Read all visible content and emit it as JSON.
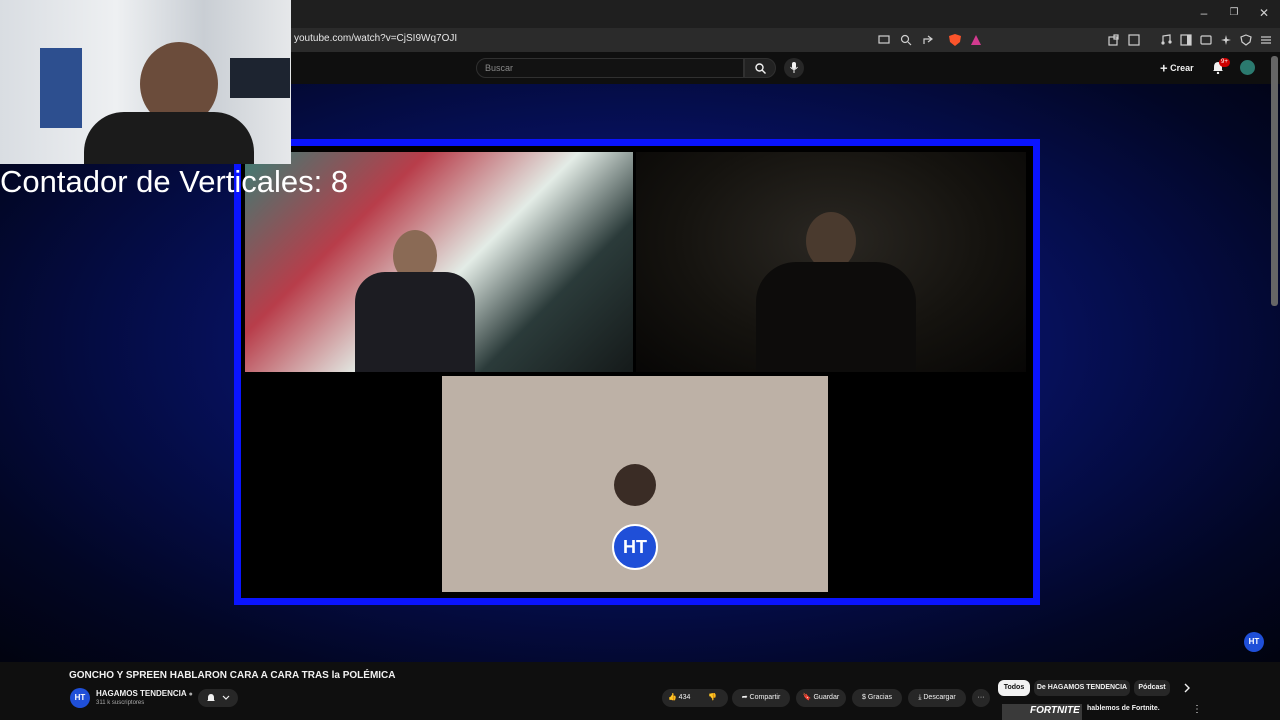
{
  "browser": {
    "url": "youtube.com/watch?v=CjSI9Wq7OJI",
    "window_controls": [
      "–",
      "❐",
      "✕"
    ],
    "shield_badge": "",
    "notification_count": "9+"
  },
  "header": {
    "search_placeholder": "Buscar",
    "create_label": "Crear"
  },
  "overlay": {
    "counter_text": "Contador de Verticales: 8"
  },
  "video": {
    "title": "GONCHO Y SPREEN HABLARON CARA A CARA TRAS la POLÉMICA",
    "channel_name": "HAGAMOS TENDENCIA",
    "subscribers": "311 k suscriptores",
    "channel_logo_text": "HT",
    "frame_color": "#0a14ff"
  },
  "actions": {
    "likes": "434",
    "share": "Compartir",
    "save": "Guardar",
    "thanks": "Gracias",
    "download": "Descargar"
  },
  "chips": [
    "Todos",
    "De HAGAMOS TENDENCIA",
    "Pódcast"
  ],
  "sidebar_preview": {
    "thumb_text": "FORTNITE",
    "title": "hablemos de Fortnite."
  }
}
